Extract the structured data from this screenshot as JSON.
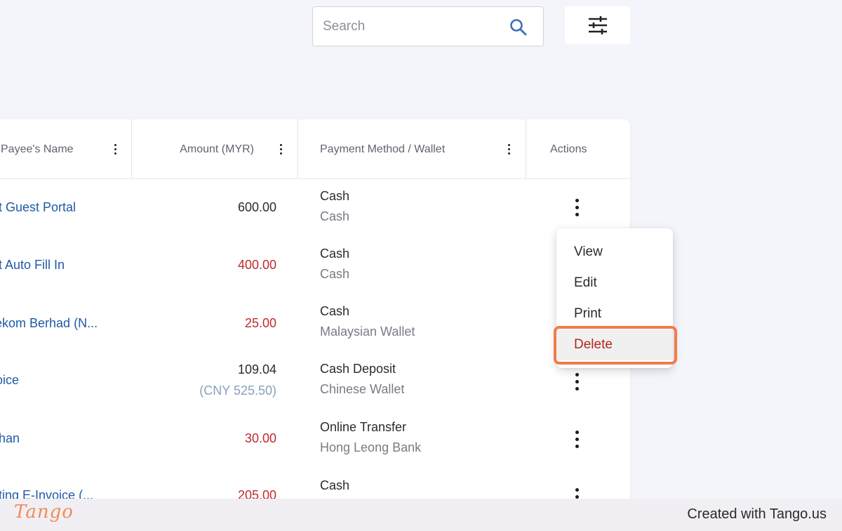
{
  "search": {
    "placeholder": "Search"
  },
  "table": {
    "columns": [
      {
        "label": "Payee's Name"
      },
      {
        "label": "Amount (MYR)"
      },
      {
        "label": "Payment Method / Wallet"
      },
      {
        "label": "Actions"
      }
    ],
    "rows": [
      {
        "payee": "Test Guest Portal",
        "amount": "600.00",
        "amount_sub": "",
        "payment_method": "Cash",
        "wallet": "Cash"
      },
      {
        "payee": "Test Auto Fill In",
        "amount": "400.00",
        "amount_sub": "",
        "payment_method": "Cash",
        "wallet": "Cash"
      },
      {
        "payee": "Telekom Berhad (N...",
        "amount": "25.00",
        "amount_sub": "",
        "payment_method": "Cash",
        "wallet": "Malaysian Wallet"
      },
      {
        "payee": "Invoice",
        "amount": "109.04",
        "amount_sub": "(CNY 525.50)",
        "payment_method": "Cash Deposit",
        "wallet": "Chinese Wallet"
      },
      {
        "payee": "Nathan",
        "amount": "30.00",
        "amount_sub": "",
        "payment_method": "Online Transfer",
        "wallet": "Hong Leong Bank"
      },
      {
        "payee": "Testing E-Invoice (...",
        "amount": "205.00",
        "amount_sub": "",
        "payment_method": "Cash",
        "wallet": ""
      }
    ]
  },
  "actions_menu": {
    "items": [
      {
        "label": "View"
      },
      {
        "label": "Edit"
      },
      {
        "label": "Print"
      },
      {
        "label": "Delete"
      }
    ]
  },
  "footer": {
    "logo": "Tango",
    "created": "Created with Tango.us"
  },
  "colors": {
    "link": "#1f5aa6",
    "negative": "#c0282d",
    "highlight": "#f07d48",
    "delete": "#b3261e"
  }
}
